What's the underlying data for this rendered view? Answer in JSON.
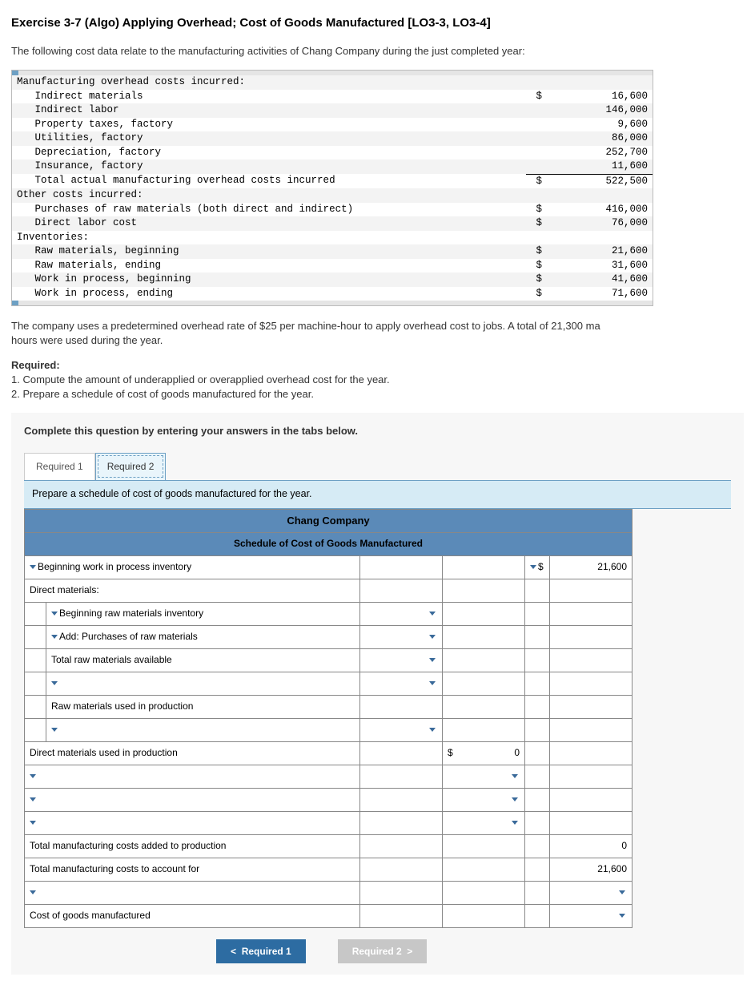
{
  "title": "Exercise 3-7 (Algo) Applying Overhead; Cost of Goods Manufactured [LO3-3, LO3-4]",
  "intro": "The following cost data relate to the manufacturing activities of Chang Company during the just completed year:",
  "cost": {
    "h_overhead": "Manufacturing overhead costs incurred:",
    "r1l": "   Indirect materials",
    "r1s": "$",
    "r1a": "16,600",
    "r2l": "   Indirect labor",
    "r2a": "146,000",
    "r3l": "   Property taxes, factory",
    "r3a": "9,600",
    "r4l": "   Utilities, factory",
    "r4a": "86,000",
    "r5l": "   Depreciation, factory",
    "r5a": "252,700",
    "r6l": "   Insurance, factory",
    "r6a": "11,600",
    "r7l": "   Total actual manufacturing overhead costs incurred",
    "r7s": "$",
    "r7a": "522,500",
    "h_other": "Other costs incurred:",
    "r8l": "   Purchases of raw materials (both direct and indirect)",
    "r8s": "$",
    "r8a": "416,000",
    "r9l": "   Direct labor cost",
    "r9s": "$",
    "r9a": "76,000",
    "h_inv": "Inventories:",
    "r10l": "   Raw materials, beginning",
    "r10s": "$",
    "r10a": "21,600",
    "r11l": "   Raw materials, ending",
    "r11s": "$",
    "r11a": "31,600",
    "r12l": "   Work in process, beginning",
    "r12s": "$",
    "r12a": "41,600",
    "r13l": "   Work in process, ending",
    "r13s": "$",
    "r13a": "71,600"
  },
  "para2a": "The company uses a predetermined overhead rate of $25 per machine-hour to apply overhead cost to jobs. A total of 21,300 ma",
  "para2b": "hours were used during the year.",
  "req_head": "Required:",
  "req1": "1. Compute the amount of underapplied or overapplied overhead cost for the year.",
  "req2": "2. Prepare a schedule of cost of goods manufactured for the year.",
  "tabs": {
    "instr": "Complete this question by entering your answers in the tabs below.",
    "t1": "Required 1",
    "t2": "Required 2",
    "prompt": "Prepare a schedule of cost of goods manufactured for the year."
  },
  "sched": {
    "company": "Chang Company",
    "subtitle": "Schedule of Cost of Goods Manufactured",
    "rows": {
      "bwip": "Beginning work in process inventory",
      "bwip_s": "$",
      "bwip_v": "21,600",
      "dm": "Direct materials:",
      "brmi": "Beginning raw materials inventory",
      "addp": "Add: Purchases of raw materials",
      "trma": "Total raw materials available",
      "rmup": "Raw materials used in production",
      "dmup": "Direct materials used in production",
      "dmup_s": "$",
      "dmup_v": "0",
      "tmcap": "Total manufacturing costs added to production",
      "tmcap_v": "0",
      "tmcaf": "Total manufacturing costs to account for",
      "tmcaf_v": "21,600",
      "cogm": "Cost of goods manufactured"
    }
  },
  "nav": {
    "prev": "Required 1",
    "next": "Required 2"
  }
}
